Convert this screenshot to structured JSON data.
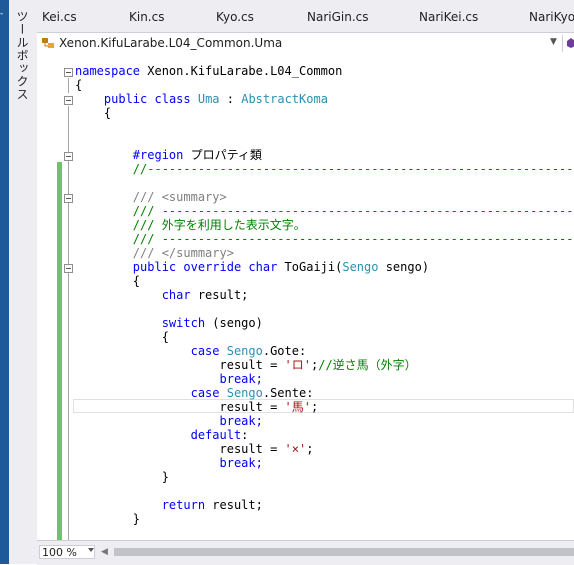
{
  "toolbox": {
    "label": "ツールボックス"
  },
  "tabs": [
    "Kei.cs",
    "Kin.cs",
    "Kyo.cs",
    "NariGin.cs",
    "NariKei.cs",
    "NariKyo"
  ],
  "navbar": {
    "path": "Xenon.KifuLarabe.L04_Common.Uma"
  },
  "code": {
    "l1_ns": "namespace",
    "l1_name": " Xenon.KifuLarabe.L04_Common",
    "l2": "{",
    "l3_public": "public",
    "l3_class": "class",
    "l3_name": "Uma",
    "l3_colon": " : ",
    "l3_base": "AbstractKoma",
    "l4": "{",
    "l7_region": "#region",
    "l7_text": " プロパティ類",
    "l8": "//------------------------------------------------------------------------",
    "l10": "/// <summary>",
    "l11": "/// ----------------------------------------------------------------------",
    "l12": "/// 外字を利用した表示文字。",
    "l13": "/// ----------------------------------------------------------------------",
    "l14": "/// </summary>",
    "l15_public": "public",
    "l15_override": "override",
    "l15_char": "char",
    "l15_name": " ToGaiji(",
    "l15_type": "Sengo",
    "l15_param": " sengo)",
    "l16": "{",
    "l17_char": "char",
    "l17_rest": " result;",
    "l19_switch": "switch",
    "l19_rest": " (sengo)",
    "l20": "{",
    "l21_case": "case",
    "l21_type": "Sengo",
    "l21_rest": ".Gote:",
    "l22_a": "result = ",
    "l22_str": "'ロ'",
    "l22_b": ";",
    "l22_cm": "//逆さ馬（外字）",
    "l23": "break;",
    "l24_case": "case",
    "l24_type": "Sengo",
    "l24_rest": ".Sente:",
    "l25_a": "result = ",
    "l25_str": "'馬'",
    "l25_b": ";",
    "l26": "break;",
    "l27_default": "default",
    "l27_rest": ":",
    "l28_a": "result = ",
    "l28_str": "'×'",
    "l28_b": ";",
    "l29": "break;",
    "l30": "}",
    "l32_return": "return",
    "l32_rest": " result;",
    "l33": "}"
  },
  "statusbar": {
    "zoom": "100 %"
  },
  "colors": {
    "keyword": "#0000ff",
    "type": "#2b91af",
    "string": "#a31515",
    "comment": "#008000",
    "doc": "#808080",
    "change_margin": "#6cc36c"
  }
}
